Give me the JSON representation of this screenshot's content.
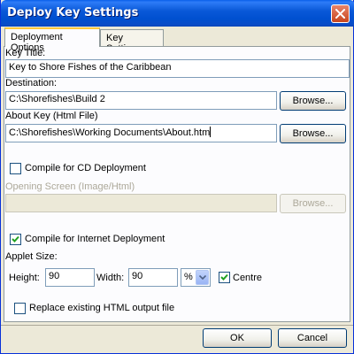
{
  "window": {
    "title": "Deploy Key Settings"
  },
  "tabs": [
    {
      "label": "Deployment Options",
      "active": true
    },
    {
      "label": "Key Settings",
      "active": false
    }
  ],
  "key_title": {
    "label": "Key Title:",
    "value": "Key to Shore Fishes of the Caribbean"
  },
  "destination": {
    "label": "Destination:",
    "value": "C:\\Shorefishes\\Build 2",
    "browse_label": "Browse..."
  },
  "about_key": {
    "label": "About Key (Html File)",
    "value": "C:\\Shorefishes\\Working Documents\\About.htm",
    "browse_label": "Browse..."
  },
  "cd_deploy": {
    "label": "Compile for CD Deployment",
    "checked": false
  },
  "opening_screen": {
    "label": "Opening Screen (Image/Html)",
    "value": "",
    "browse_label": "Browse...",
    "enabled": false
  },
  "internet_deploy": {
    "label": "Compile for Internet Deployment",
    "checked": true
  },
  "applet_size": {
    "label": "Applet Size:",
    "height_label": "Height:",
    "height_value": "90",
    "width_label": "Width:",
    "width_value": "90",
    "unit_value": "%",
    "centre_label": "Centre",
    "centre_checked": true
  },
  "replace_html": {
    "label": "Replace existing HTML output file",
    "checked": false
  },
  "buttons": {
    "ok_label": "OK",
    "cancel_label": "Cancel"
  },
  "colors": {
    "titlebar": "#0A59D8",
    "dialog_bg": "#ECE9D8",
    "panel_bg": "#FCFCFE",
    "check_green": "#21A121",
    "active_tab_accent": "#FFC83C"
  }
}
